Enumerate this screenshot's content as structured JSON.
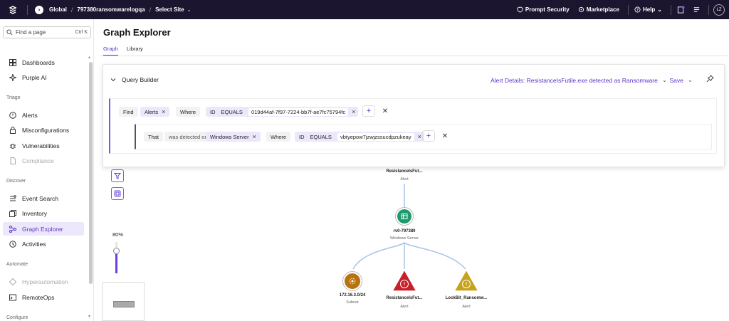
{
  "topbar": {
    "scope": "Global",
    "account": "797380ransomwarelogqa",
    "site": "Select Site",
    "prompt_security": "Prompt Security",
    "marketplace": "Marketplace",
    "help": "Help",
    "avatar": "LZ"
  },
  "sidebar": {
    "search_placeholder": "Find a page",
    "search_shortcut": "Ctrl K",
    "items": [
      {
        "label": "Dashboards",
        "icon": "grid-icon"
      },
      {
        "label": "Purple AI",
        "icon": "sparkle-icon"
      }
    ],
    "sections": [
      "Triage",
      "Discover",
      "Automate",
      "Configure"
    ],
    "triage": [
      "Alerts",
      "Misconfigurations",
      "Vulnerabilities",
      "Compliance"
    ],
    "discover": [
      "Event Search",
      "Inventory",
      "Graph Explorer",
      "Activities"
    ],
    "automate": [
      "Hyperautomation",
      "RemoteOps"
    ]
  },
  "main": {
    "title": "Graph Explorer",
    "tabs": [
      "Graph",
      "Library"
    ]
  },
  "query_builder": {
    "title": "Query Builder",
    "alert_details": "Alert Details: ResistanceIsFutile.exe detected as Ransomware",
    "save": "Save",
    "row1": {
      "find": "Find",
      "entity": "Alerts",
      "where": "Where",
      "field": "ID",
      "op": "EQUALS",
      "value": "019d44af-7f97-7224-bb7f-ae7fc75794fc"
    },
    "row2": {
      "that": "That",
      "relation": "was detected on",
      "entity": "Windows Server",
      "where": "Where",
      "field": "ID",
      "op": "EQUALS",
      "value": "vbtyepow7jzwjzssucdpzukeay"
    }
  },
  "graph": {
    "zoom": "80%",
    "zoom_level": 0.8,
    "nodes": [
      {
        "label": "ResistanceIsFut...",
        "sub": "Alert"
      },
      {
        "label": "rv0-797380",
        "sub": "Windows Server"
      },
      {
        "label": "172.16.3.0/24",
        "sub": "Subnet"
      },
      {
        "label": "ResistanceIsFut...",
        "sub": "Alert"
      },
      {
        "label": "LockBit_Ransomw...",
        "sub": "Alert"
      }
    ],
    "colors": {
      "server": "#1e9b6e",
      "subnet": "#b8730f",
      "alert_red": "#c8202a",
      "alert_yellow": "#c7a21b",
      "accent": "#5a33c7"
    }
  }
}
